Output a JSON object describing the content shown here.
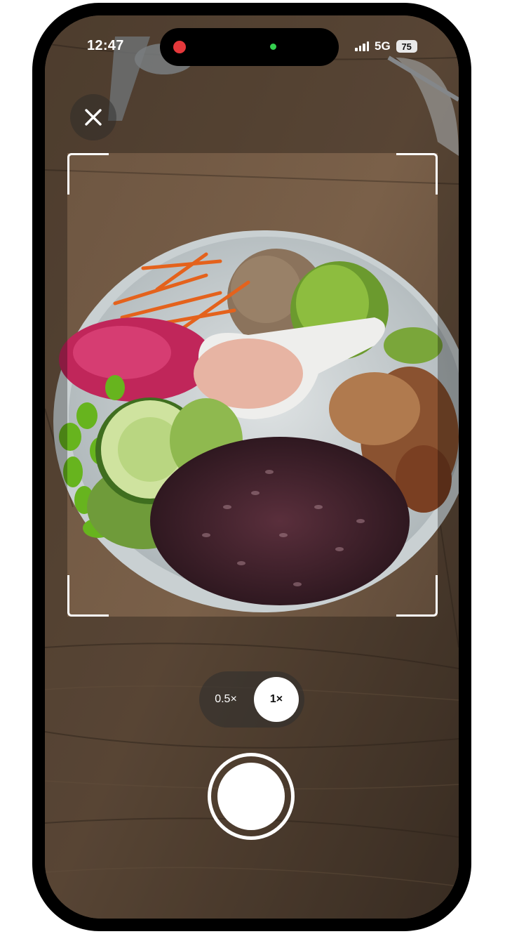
{
  "status_bar": {
    "time": "12:47",
    "network": "5G",
    "battery": "75"
  },
  "controls": {
    "close_icon": "close-icon",
    "zoom_options": [
      "0.5×",
      "1×"
    ],
    "selected_zoom": "1×"
  },
  "colors": {
    "recording_indicator": "#e5383b",
    "camera_indicator": "#35d04f",
    "frame_corners": "#ffffff"
  }
}
